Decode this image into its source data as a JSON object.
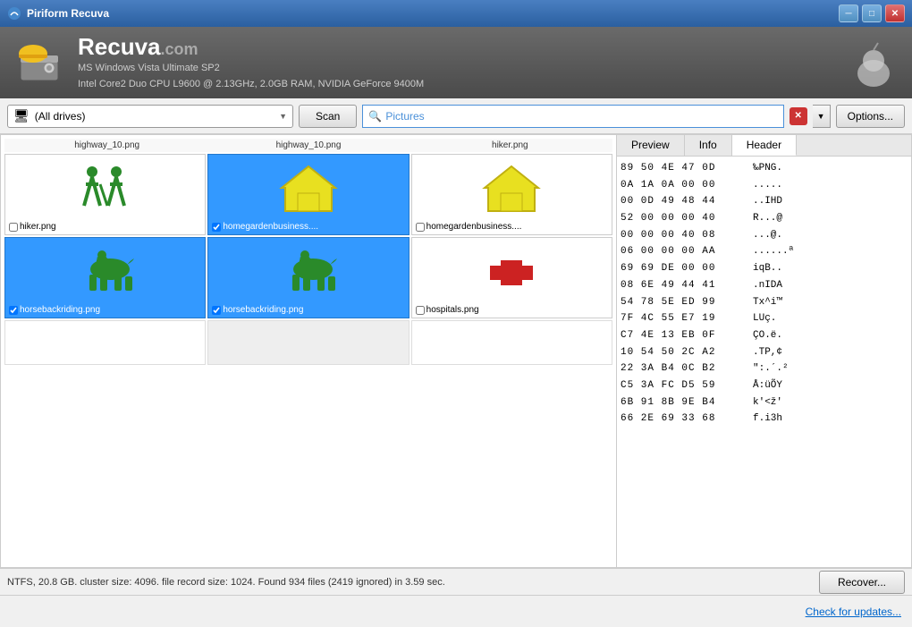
{
  "titleBar": {
    "title": "Piriform Recuva",
    "controls": [
      "minimize",
      "maximize",
      "close"
    ]
  },
  "header": {
    "appName": "Recuva",
    "domain": ".com",
    "line1": "MS Windows Vista Ultimate SP2",
    "line2": "Intel Core2 Duo CPU L9600 @ 2.13GHz, 2.0GB RAM, NVIDIA GeForce 9400M"
  },
  "toolbar": {
    "driveLabel": "(All drives)",
    "scanLabel": "Scan",
    "filterLabel": "Pictures",
    "optionsLabel": "Options..."
  },
  "fileGrid": {
    "topNames": [
      "highway_10.png",
      "highway_10.png",
      "hiker.png"
    ],
    "row1": [
      {
        "name": "hiker.png",
        "selected": false,
        "type": "hiker"
      },
      {
        "name": "homegardenbusiness....",
        "selected": true,
        "type": "home"
      },
      {
        "name": "homegardenbusiness....",
        "selected": false,
        "type": "home"
      }
    ],
    "row2": [
      {
        "name": "horsebackriding.png",
        "selected": true,
        "type": "horse"
      },
      {
        "name": "horsebackriding.png",
        "selected": true,
        "type": "horse"
      },
      {
        "name": "hospitals.png",
        "selected": false,
        "type": "cross"
      }
    ]
  },
  "rightPanel": {
    "tabs": [
      "Preview",
      "Info",
      "Header"
    ],
    "activeTab": "Header",
    "hexData": [
      {
        "bytes": "89 50 4E 47 0D",
        "ascii": "‰PNG."
      },
      {
        "bytes": "0A 1A 0A 00 00",
        "ascii": "....."
      },
      {
        "bytes": "00 0D 49 48 44",
        "ascii": "..IHD"
      },
      {
        "bytes": "52 00 00 00 40",
        "ascii": "R...@"
      },
      {
        "bytes": "00 00 00 40 08",
        "ascii": "...@."
      },
      {
        "bytes": "06 00 00 00 AA",
        "ascii": "......ª"
      },
      {
        "bytes": "69 69 DE 00 00",
        "ascii": "iqB.."
      },
      {
        "bytes": "08 6E 49 44 41",
        "ascii": ".nIDA"
      },
      {
        "bytes": "54 78 5E ED 99",
        "ascii": "Tx^i™"
      },
      {
        "bytes": "7F 4C 55 E7 19",
        "ascii": "LUç."
      },
      {
        "bytes": "C7 4E 13 EB 0F",
        "ascii": "ÇO.ë."
      },
      {
        "bytes": "10 54 50 2C A2",
        "ascii": ".TP,¢"
      },
      {
        "bytes": "22 3A B4 0C B2",
        "ascii": "\":.´.²"
      },
      {
        "bytes": "C5 3A FC D5 59",
        "ascii": "Å:üÕY"
      },
      {
        "bytes": "6B 91 8B 9E B4",
        "ascii": "k'<ž'"
      },
      {
        "bytes": "66 2E 69 33 68",
        "ascii": "f.i3h"
      }
    ]
  },
  "statusBar": {
    "text": "NTFS, 20.8 GB. cluster size: 4096. file record size: 1024. Found 934 files (2419 ignored) in 3.59 sec.",
    "recoverLabel": "Recover..."
  },
  "bottomBar": {
    "checkUpdatesLabel": "Check for updates..."
  }
}
